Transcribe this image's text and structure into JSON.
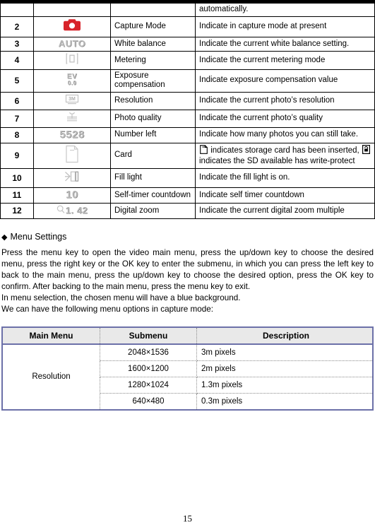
{
  "page": {
    "number": "15"
  },
  "icon_table": {
    "partial_row": {
      "num": "",
      "icon": "",
      "name": "",
      "desc": "automatically."
    },
    "rows": [
      {
        "num": "2",
        "icon_name": "camera-icon",
        "icon_text": "",
        "name": "Capture Mode",
        "desc": "Indicate in capture mode at present"
      },
      {
        "num": "3",
        "icon_name": "auto-white-balance-icon",
        "icon_text": "AUTO",
        "name": "White balance",
        "desc": "Indicate the current white balance setting."
      },
      {
        "num": "4",
        "icon_name": "metering-icon",
        "icon_text": "",
        "name": "Metering",
        "desc": "Indicate the current metering mode"
      },
      {
        "num": "5",
        "icon_name": "exposure-compensation-icon",
        "icon_text": "EV",
        "icon_text_sub": "0.0",
        "name": "Exposure compensation",
        "desc": "Indicate exposure compensation value"
      },
      {
        "num": "6",
        "icon_name": "resolution-icon",
        "icon_text": "",
        "name": "Resolution",
        "desc": "Indicate the current photo’s resolution"
      },
      {
        "num": "7",
        "icon_name": "photo-quality-icon",
        "icon_text": "",
        "name": "Photo quality",
        "desc": "Indicate the current photo’s quality"
      },
      {
        "num": "8",
        "icon_name": "number-left-icon",
        "icon_text": "5528",
        "name": "Number left",
        "desc": "Indicate how many photos you can still take."
      },
      {
        "num": "9",
        "icon_name": "memory-card-icon",
        "icon_text": "",
        "name": "Card",
        "desc_part1": "indicates storage card has been inserted,",
        "desc_part2": "indicates the SD available has write-protect",
        "desc_icon1": "card-inserted-icon",
        "desc_icon2": "card-write-protect-icon"
      },
      {
        "num": "10",
        "icon_name": "fill-light-icon",
        "icon_text": "",
        "name": "Fill light",
        "desc": "Indicate the fill light is on."
      },
      {
        "num": "11",
        "icon_name": "self-timer-countdown-icon",
        "icon_text": "10",
        "name": "Self-timer countdown",
        "desc": "Indicate self timer countdown"
      },
      {
        "num": "12",
        "icon_name": "digital-zoom-icon",
        "icon_text": "1. 42",
        "name": "Digital zoom",
        "desc": "Indicate the current digital zoom multiple"
      }
    ]
  },
  "menu_settings": {
    "heading": "Menu Settings",
    "heading_bullet": "◆",
    "paragraph": "Press the menu key to open the video main menu, press the up/down key to choose the desired menu, press the right key or the OK key to enter the submenu, in which you can press the left key to back to the main menu, press the up/down key to choose the desired option, press the OK key to confirm. After backing to the main menu, press the menu key to exit.",
    "line2": "In menu selection, the chosen menu will have a blue background.",
    "line3": "We can have the following menu options in capture mode:"
  },
  "menu_table": {
    "headers": {
      "main": "Main Menu",
      "sub": "Submenu",
      "desc": "Description"
    },
    "main_menu_label": "Resolution",
    "rows": [
      {
        "sub": "2048×1536",
        "desc": "3m pixels"
      },
      {
        "sub": "1600×1200",
        "desc": "2m pixels"
      },
      {
        "sub": "1280×1024",
        "desc": "1.3m pixels"
      },
      {
        "sub": "640×480",
        "desc": "0.3m pixels"
      }
    ]
  },
  "colors": {
    "camera_icon": "#d8232a",
    "menu_table_border": "#6c70a8",
    "menu_table_header_bg": "#e9e9e9",
    "lcd_glyph": "#b9b9b9"
  }
}
